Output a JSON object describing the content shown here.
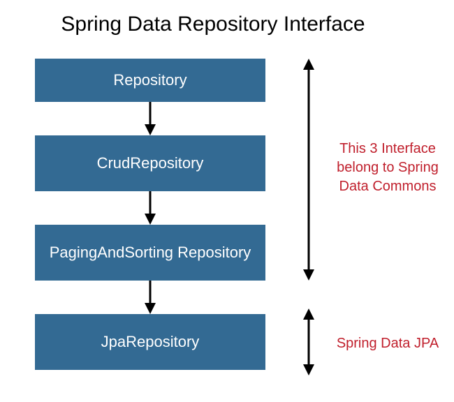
{
  "title": "Spring Data Repository Interface",
  "boxes": {
    "repository": "Repository",
    "crud": "CrudRepository",
    "paging": "PagingAndSorting Repository",
    "jpa": "JpaRepository"
  },
  "annotations": {
    "commons": "This 3 Interface belong to Spring Data Commons",
    "jpa": "Spring Data JPA"
  },
  "colors": {
    "box_bg": "#336a93",
    "box_text": "#ffffff",
    "annotation": "#c01f2c",
    "arrow": "#000000"
  }
}
